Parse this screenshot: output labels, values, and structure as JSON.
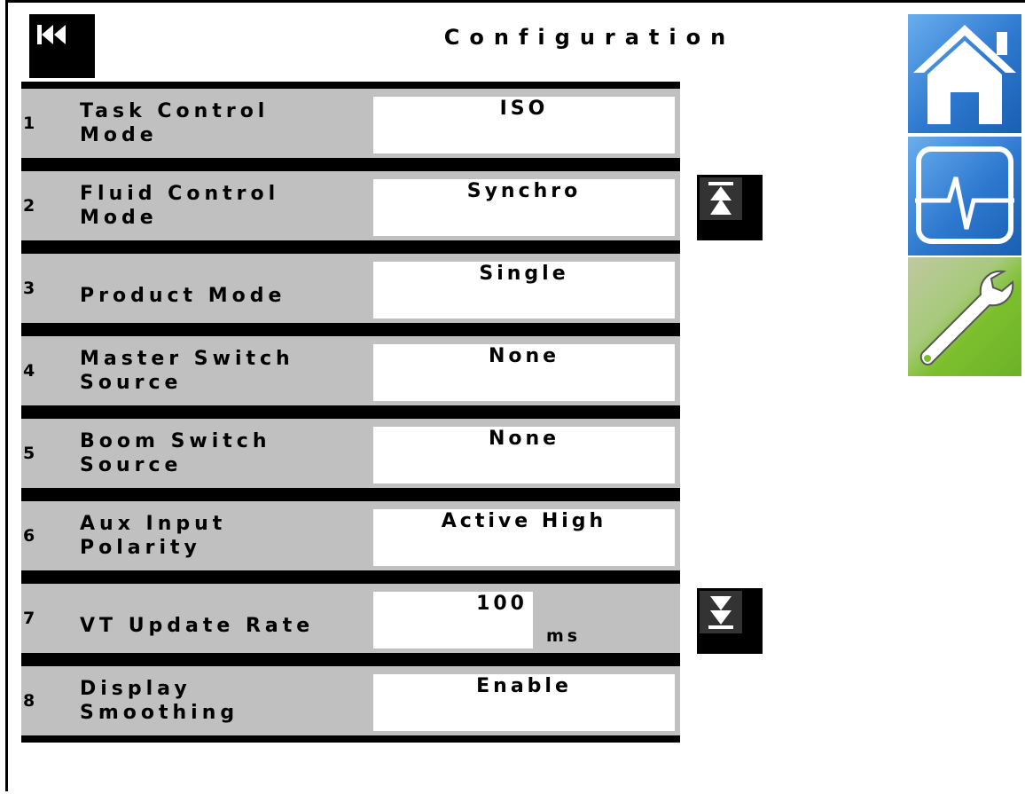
{
  "header": {
    "title": "Configuration"
  },
  "rows": [
    {
      "number": "1",
      "label_line1": "Task Control",
      "label_line2": "Mode",
      "value": "ISO"
    },
    {
      "number": "2",
      "label_line1": "Fluid Control",
      "label_line2": "Mode",
      "value": "Synchro"
    },
    {
      "number": "3",
      "label_line1": "Product Mode",
      "label_line2": "",
      "value": "Single"
    },
    {
      "number": "4",
      "label_line1": "Master Switch",
      "label_line2": "Source",
      "value": "None"
    },
    {
      "number": "5",
      "label_line1": "Boom Switch",
      "label_line2": "Source",
      "value": "None"
    },
    {
      "number": "6",
      "label_line1": "Aux Input",
      "label_line2": "Polarity",
      "value": "Active High"
    },
    {
      "number": "7",
      "label_line1": "VT Update Rate",
      "label_line2": "",
      "value": "100",
      "unit": "ms"
    },
    {
      "number": "8",
      "label_line1": "Display",
      "label_line2": "Smoothing",
      "value": "Enable"
    }
  ],
  "icons": {
    "back": "skip-back-icon",
    "scroll_top": "scroll-to-top-icon",
    "scroll_bottom": "scroll-to-bottom-icon",
    "home": "home-icon",
    "diagnostics": "heartbeat-icon",
    "settings": "wrench-icon"
  },
  "colors": {
    "row_background": "#c0c0c0",
    "value_background": "#ffffff",
    "home_button": "#2d78cf",
    "settings_button": "#7cbf2d"
  }
}
